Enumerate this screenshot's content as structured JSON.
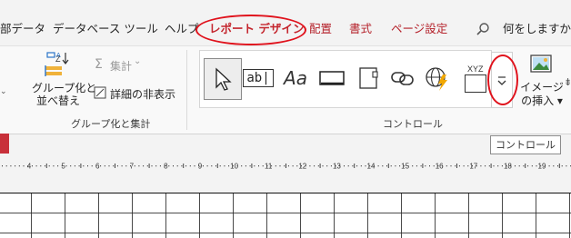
{
  "tabs": [
    {
      "label": "部データ"
    },
    {
      "label": "データベース ツール"
    },
    {
      "label": "ヘルプ"
    },
    {
      "label": "レポート デザイン"
    },
    {
      "label": "配置"
    },
    {
      "label": "書式"
    },
    {
      "label": "ページ設定"
    }
  ],
  "search": {
    "label": "何をしますか"
  },
  "group_aggregate": {
    "group_sort_label_line1": "グループ化と",
    "group_sort_label_line2": "並べ替え",
    "totals_label": "集計",
    "hide_details_label": "詳細の非表示",
    "group_name": "グループ化と集計"
  },
  "controls": {
    "group_name": "コントロール",
    "textbox_glyph": "ab|",
    "label_glyph": "Aa",
    "unbound_glyph": "XYZ",
    "more_tooltip": "コントロール"
  },
  "image_insert": {
    "label_line1": "イメージ",
    "label_line2": "の挿入 ▾"
  },
  "ruler": {
    "numbers": [
      "4",
      "5",
      "6",
      "7",
      "8",
      "9",
      "10",
      "11",
      "12",
      "13",
      "14",
      "15",
      "16",
      "17",
      "18",
      "19"
    ]
  },
  "colors": {
    "accent_red": "#b5222b",
    "highlight_red": "#e0121c",
    "ribbon_bg": "#f9f9f9",
    "tab_bg": "#f3f3f3"
  }
}
